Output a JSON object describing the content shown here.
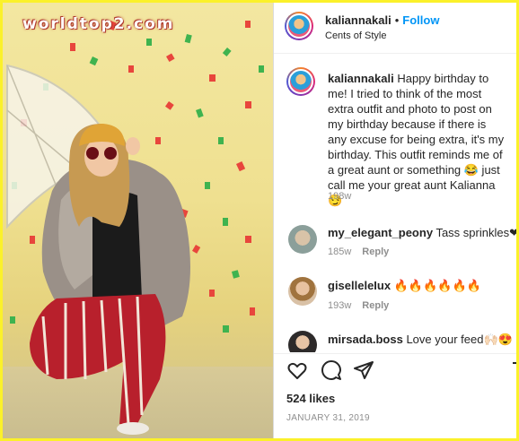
{
  "watermark": "worldtop2.com",
  "post": {
    "username": "kaliannakali",
    "follow_label": "Follow",
    "separator": "•",
    "location": "Cents of Style",
    "caption": "Happy birthday to me! I tried to think of the most extra outfit and photo to post on my birthday because if there is any excuse for being extra, it's my birthday. This outfit reminds me of a great aunt or something 😂 just call me your great aunt Kalianna 😏",
    "caption_age": "198w",
    "likes": "524 likes",
    "date": "JANUARY 31, 2019"
  },
  "comments": [
    {
      "username": "my_elegant_peony",
      "text": "Tass sprinkles❤",
      "age": "185w",
      "reply": "Reply"
    },
    {
      "username": "giselleleIux",
      "text": "🔥🔥🔥🔥🔥🔥",
      "age": "193w",
      "reply": "Reply"
    },
    {
      "username": "mirsada.boss",
      "text": "Love your feed🙌🏻😍",
      "age": "",
      "reply": ""
    }
  ],
  "icons": [
    "heart-icon",
    "comment-icon",
    "share-icon",
    "bookmark-icon"
  ],
  "colors": {
    "follow": "#0095f6",
    "border": "#fbf12a",
    "text": "#262626",
    "muted": "#8e8e8e"
  }
}
